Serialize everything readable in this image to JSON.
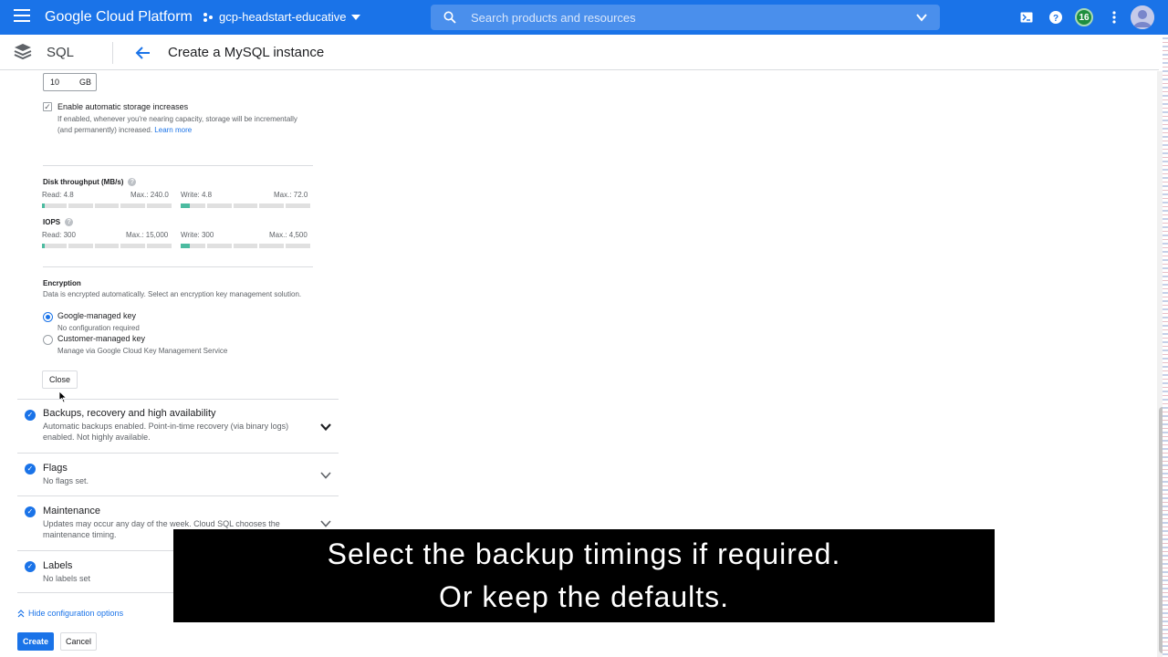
{
  "topbar": {
    "brand": "Google Cloud Platform",
    "project": "gcp-headstart-educative",
    "search_placeholder": "Search products and resources",
    "notification_count": "16",
    "accent": "#1a73e8"
  },
  "subbar": {
    "product": "SQL",
    "page_title": "Create a MySQL instance"
  },
  "storage": {
    "value": "10",
    "unit": "GB",
    "auto_label": "Enable automatic storage increases",
    "auto_desc": "If enabled, whenever you're nearing capacity, storage will be incrementally (and permanently) increased.",
    "learn_more": "Learn more",
    "auto_checked": true
  },
  "throughput": {
    "label": "Disk throughput (MB/s)",
    "read": "Read: 4.8",
    "read_max": "Max.: 240.0",
    "write": "Write: 4.8",
    "write_max": "Max.: 72.0",
    "read_fraction": 0.02,
    "write_fraction": 0.067
  },
  "iops": {
    "label": "IOPS",
    "read": "Read: 300",
    "read_max": "Max.: 15,000",
    "write": "Write: 300",
    "write_max": "Max.: 4,500",
    "read_fraction": 0.02,
    "write_fraction": 0.067
  },
  "encryption": {
    "title": "Encryption",
    "desc": "Data is encrypted automatically. Select an encryption key management solution.",
    "opt1_label": "Google-managed key",
    "opt1_sub": "No configuration required",
    "opt2_label": "Customer-managed key",
    "opt2_sub": "Manage via Google Cloud Key Management Service",
    "selected": "Google-managed key"
  },
  "close_label": "Close",
  "panels": [
    {
      "title": "Backups, recovery and high availability",
      "desc": "Automatic backups enabled. Point-in-time recovery (via binary logs) enabled. Not highly available."
    },
    {
      "title": "Flags",
      "desc": "No flags set."
    },
    {
      "title": "Maintenance",
      "desc": "Updates may occur any day of the week. Cloud SQL chooses the maintenance timing."
    },
    {
      "title": "Labels",
      "desc": "No labels set"
    }
  ],
  "hide_options": "Hide configuration options",
  "create_label": "Create",
  "cancel_label": "Cancel",
  "caption": {
    "line1": "Select the backup timings if required.",
    "line2": "Or keep the defaults."
  }
}
